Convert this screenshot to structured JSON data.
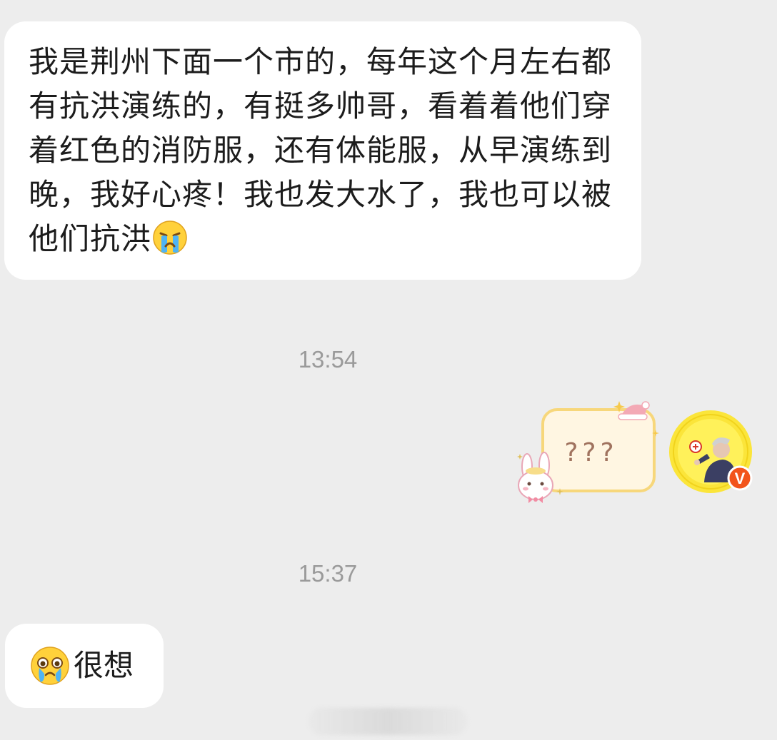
{
  "messages": [
    {
      "sender": "other",
      "text": "我是荆州下面一个市的，每年这个月左右都有抗洪演练的，有挺多帅哥，看着着他们穿着红色的消防服，还有体能服，从早演练到晚，我好心疼！我也发大水了，我也可以被他们抗洪",
      "trailing_emoji": "loudly-crying-face-emoji"
    },
    {
      "sender": "self",
      "sticker_text": "???",
      "sticker": "bunny-question-sticker",
      "avatar": "verified-user-avatar",
      "badge_text": "V"
    },
    {
      "sender": "other",
      "leading_emoji": "crying-face-emoji",
      "text": "很想"
    }
  ],
  "timestamps": [
    "13:54",
    "15:37"
  ],
  "colors": {
    "background": "#ededed",
    "bubble": "#ffffff",
    "text": "#1c1c1c",
    "timestamp": "#9a9a9a",
    "avatar_ring": "#f8e522",
    "verified_badge": "#f2541b",
    "sticker_border": "#f7d77b"
  }
}
